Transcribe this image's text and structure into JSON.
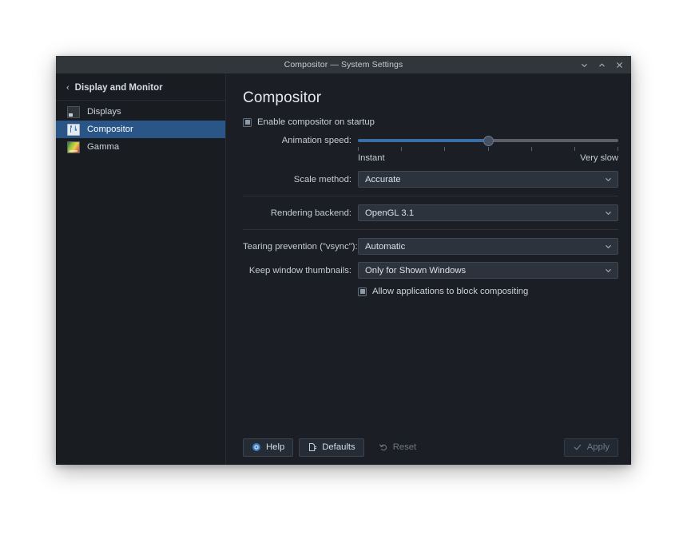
{
  "window": {
    "title": "Compositor — System Settings",
    "controls": [
      {
        "name": "minimize",
        "glyph": "chevron-down"
      },
      {
        "name": "maximize",
        "glyph": "chevron-up"
      },
      {
        "name": "close",
        "glyph": "x"
      }
    ]
  },
  "sidebar": {
    "breadcrumb": {
      "back_glyph": "‹",
      "label": "Display and Monitor"
    },
    "items": [
      {
        "label": "Displays",
        "icon": "monitor-icon",
        "selected": false
      },
      {
        "label": "Compositor",
        "icon": "sliders-panel-icon",
        "selected": true
      },
      {
        "label": "Gamma",
        "icon": "color-gradient-icon",
        "selected": false
      }
    ]
  },
  "main": {
    "title": "Compositor",
    "enable_compositor": {
      "label": "Enable compositor on startup",
      "checked": true
    },
    "animation_speed": {
      "label": "Animation speed:",
      "value_percent": 50,
      "tick_count": 7,
      "min_label": "Instant",
      "max_label": "Very slow"
    },
    "scale_method": {
      "label": "Scale method:",
      "value": "Accurate"
    },
    "rendering_backend": {
      "label": "Rendering backend:",
      "value": "OpenGL 3.1"
    },
    "tearing_prevention": {
      "label": "Tearing prevention (\"vsync\"):",
      "value": "Automatic"
    },
    "keep_window_thumbnails": {
      "label": "Keep window thumbnails:",
      "value": "Only for Shown Windows"
    },
    "allow_block_compositing": {
      "label": "Allow applications to block compositing",
      "checked": true
    }
  },
  "footer": {
    "help_label": "Help",
    "defaults_label": "Defaults",
    "reset_label": "Reset",
    "apply_label": "Apply"
  },
  "colors": {
    "accent": "#2a5587",
    "slider_fill": "#3a6ea5",
    "window_bg": "#1b1e24",
    "sidebar_bg": "#191c21",
    "titlebar_bg": "#31363b"
  }
}
